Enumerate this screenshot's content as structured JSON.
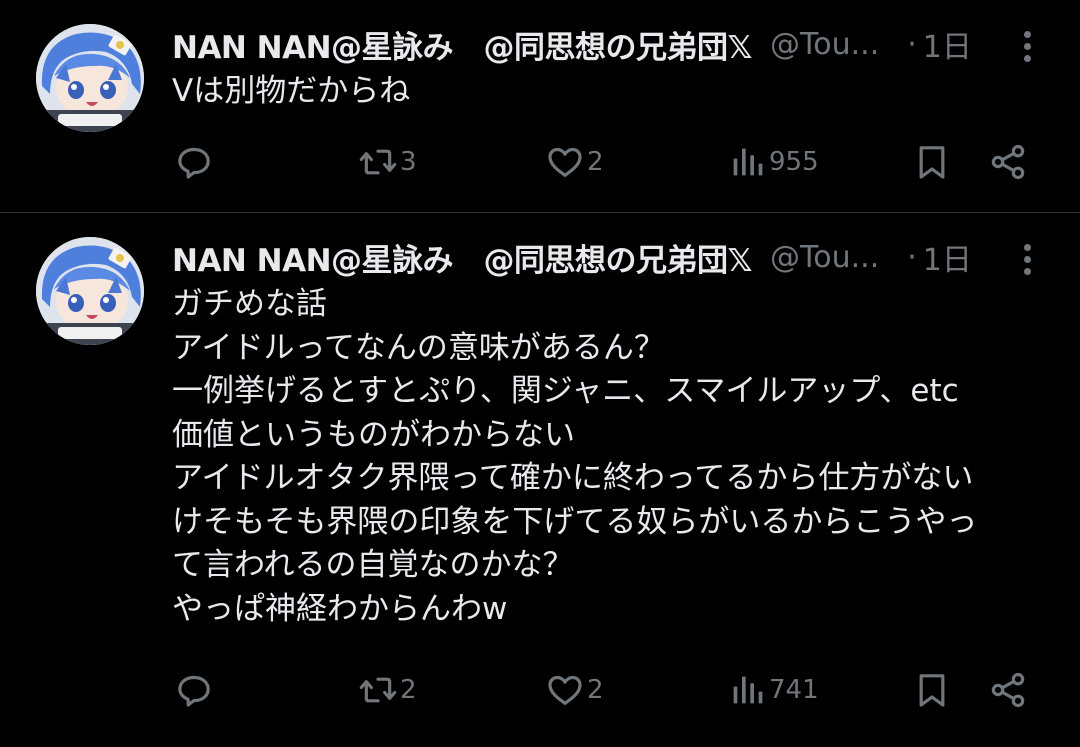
{
  "tweets": [
    {
      "author": {
        "display_name": "NAN NAN@星詠み　@同思想の兄弟団𝕏",
        "handle": "@Tou...",
        "avatar": "avatar-anime-girl-blue-hair"
      },
      "separator": "·",
      "time": "1日",
      "text_lines": [
        "Vは別物だからね"
      ],
      "actions": {
        "reply_count": "",
        "retweet_count": "3",
        "like_count": "2",
        "views_count": "955"
      }
    },
    {
      "author": {
        "display_name": "NAN NAN@星詠み　@同思想の兄弟団𝕏",
        "handle": "@Tou...",
        "avatar": "avatar-anime-girl-blue-hair"
      },
      "separator": "·",
      "time": "1日",
      "text_lines": [
        "ガチめな話",
        "アイドルってなんの意味があるん？",
        "一例挙げるとすとぷり、関ジャニ、スマイルアップ、etc",
        "価値というものがわからない",
        "アイドルオタク界隈って確かに終わってるから仕方がない",
        "けそもそも界隈の印象を下げてる奴らがいるからこうやっ",
        "て言われるの自覚なのかな？",
        "やっぱ神経わからんわw"
      ],
      "actions": {
        "reply_count": "",
        "retweet_count": "2",
        "like_count": "2",
        "views_count": "741"
      }
    }
  ],
  "icons": {
    "reply": "reply-icon",
    "retweet": "retweet-icon",
    "like": "like-icon",
    "views": "views-icon",
    "bookmark": "bookmark-icon",
    "share": "share-icon",
    "more": "more-icon"
  },
  "colors": {
    "background": "#000000",
    "text_primary": "#e7e9ea",
    "text_secondary": "#71767b",
    "divider": "#2f3336"
  }
}
